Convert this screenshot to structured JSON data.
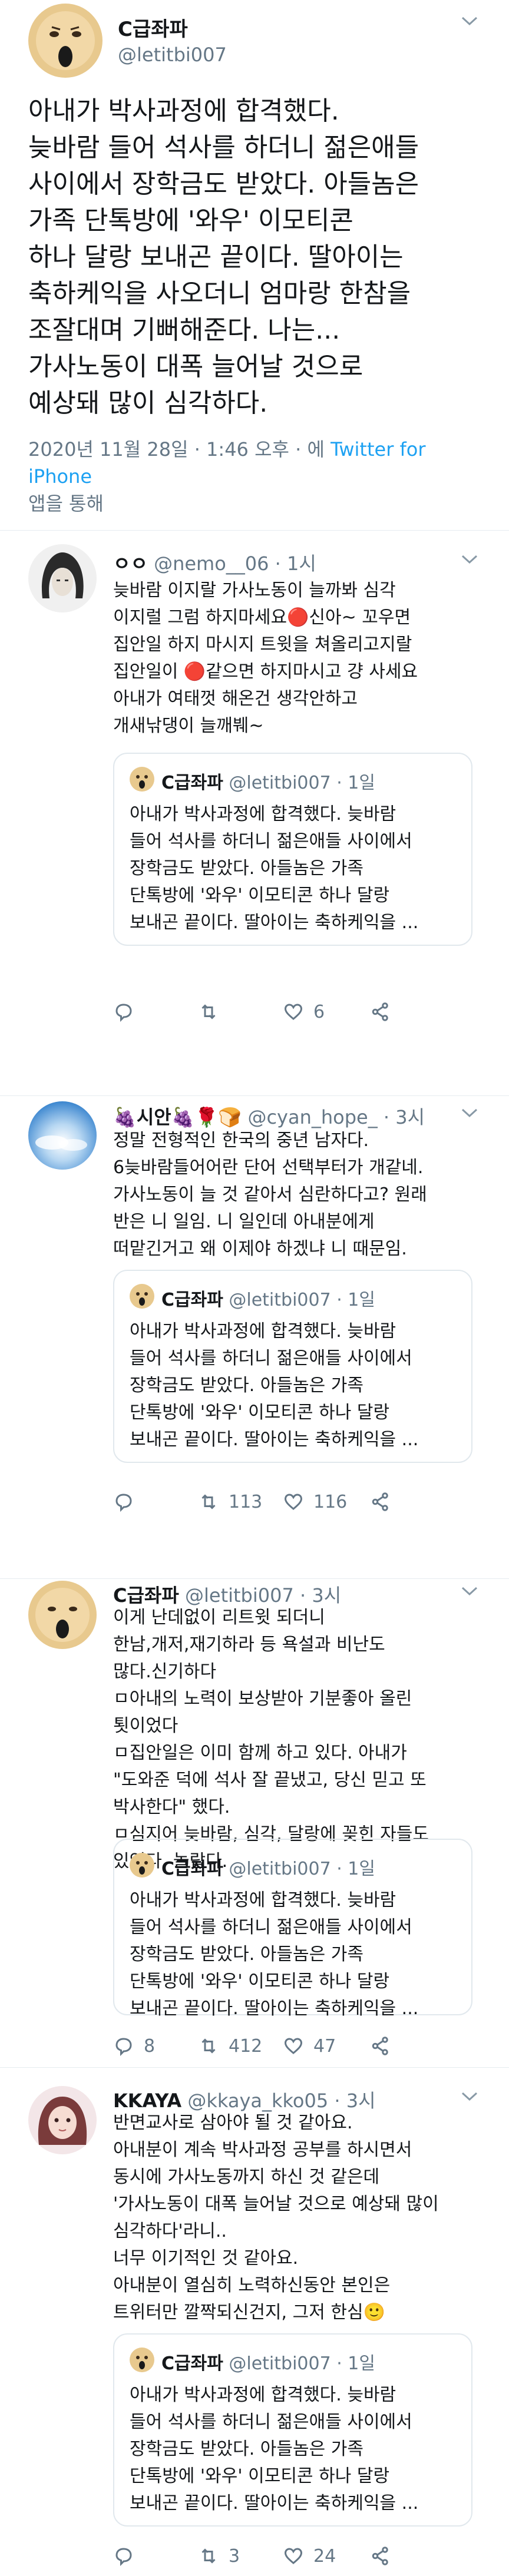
{
  "main": {
    "name": "C급좌파",
    "handle": "@letitbi007",
    "text": "아내가 박사과정에 합격했다.\n늦바람 들어 석사를 하더니 젊은애들\n사이에서 장학금도 받았다. 아들놈은\n가족 단톡방에 '와우' 이모티콘\n하나 달랑 보내곤 끝이다. 딸아이는\n축하케익을 사오더니 엄마랑 한참을\n조잘대며 기뻐해준다. 나는...\n가사노동이 대폭 늘어날 것으로\n예상돼 많이 심각하다.",
    "timestamp": "2020년 11월 28일 · 1:46 오후 · 에 ",
    "via": "Twitter for iPhone",
    "timestamp_tail": "\n앱을 통해"
  },
  "quote": {
    "name": "C급좌파",
    "handle": "@letitbi007 · 1일",
    "text": "아내가 박사과정에 합격했다. 늦바람\n들어 석사를 하더니 젊은애들 사이에서\n장학금도 받았다. 아들놈은 가족\n단톡방에 '와우' 이모티콘 하나 달랑\n보내곤 끝이다. 딸아이는 축하케익을 ..."
  },
  "replies": [
    {
      "name": "ㅇㅇ",
      "handle": "@nemo__06 · 1시",
      "text": "늦바람 이지랄 가사노동이 늘까봐 심각\n이지럴 그럼 하지마세요🔴신아~ 꼬우면\n집안일 하지 마시지 트윗을 쳐올리고지랄\n집안일이 🔴같으면 하지마시고 걍 사세요\n아내가 여태껏 해온건 생각안하고\n개새낚댕이 늘깨붸~",
      "reply_count": "",
      "retweet_count": "",
      "like_count": "6"
    },
    {
      "name": "🍇시안🍇🌹🍞",
      "handle": "@cyan_hope_ · 3시",
      "text": "정말 전형적인 한국의 중년 남자다.\n6늦바람들어어란 단어 선택부터가 개같네.\n가사노동이 늘 것 같아서 심란하다고? 원래\n반은 니 일임. 니 일인데 아내분에게\n떠맡긴거고 왜 이제야 하겠냐 니 때문임.",
      "reply_count": "",
      "retweet_count": "113",
      "like_count": "116"
    },
    {
      "name": "C급좌파",
      "handle": "@letitbi007 · 3시",
      "text": "이게 난데없이 리트윗 되더니\n한남,개저,재기하라 등 욕설과 비난도\n많다.신기하다\nㅁ아내의 노력이 보상받아 기분좋아 올린\n툇이었다\nㅁ집안일은  이미 함께 하고 있다. 아내가\n\"도와준 덕에 석사 잘 끝냈고, 당신 믿고 또\n박사한다\" 했다.\nㅁ심지어 늦바람, 심각, 달랑에 꽂힌 자들도\n있었다. 놀랍다.",
      "reply_count": "8",
      "retweet_count": "412",
      "like_count": "47"
    },
    {
      "name": "KKAYA",
      "handle": "@kkaya_kko05 · 3시",
      "text": "반면교사로 삼아야 될 것 같아요.\n아내분이 계속 박사과정 공부를 하시면서\n동시에 가사노동까지 하신 것 같은데\n'가사노동이 대폭 늘어날 것으로 예상돼 많이\n심각하다'라니..\n너무 이기적인 것 같아요.\n아내분이 열심히 노력하신동안 본인은\n트위터만 깔짝되신건지, 그저 한심🙂",
      "reply_count": "",
      "retweet_count": "3",
      "like_count": "24"
    }
  ],
  "colors": {
    "accent": "#1da1f2",
    "muted": "#657786",
    "text": "#14171a",
    "divider": "#e6ecf0"
  }
}
